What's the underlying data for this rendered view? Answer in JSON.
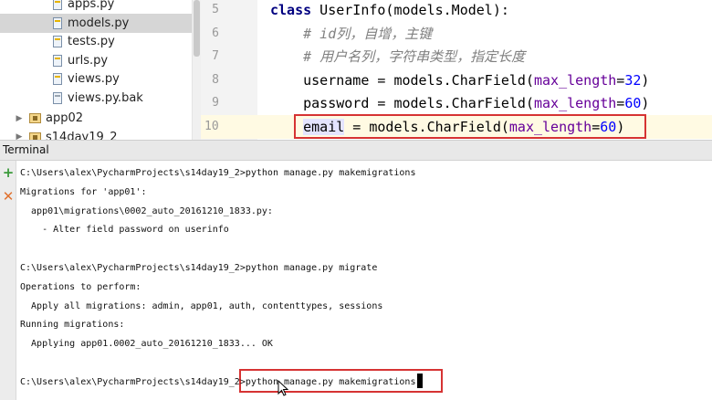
{
  "project_tree": {
    "files": [
      {
        "label": "apps.py",
        "selected": false,
        "icon": "python-file-icon"
      },
      {
        "label": "models.py",
        "selected": true,
        "icon": "python-file-icon"
      },
      {
        "label": "tests.py",
        "selected": false,
        "icon": "python-file-icon"
      },
      {
        "label": "urls.py",
        "selected": false,
        "icon": "python-file-icon"
      },
      {
        "label": "views.py",
        "selected": false,
        "icon": "python-file-icon"
      },
      {
        "label": "views.py.bak",
        "selected": false,
        "icon": "text-file-icon"
      }
    ],
    "folders": [
      {
        "label": "app02",
        "icon": "package-folder-icon"
      },
      {
        "label": "s14day19_2",
        "icon": "package-folder-icon"
      }
    ]
  },
  "editor": {
    "lines": [
      {
        "num": "5",
        "segments": [
          {
            "t": "class",
            "c": "kw"
          },
          {
            "t": " UserInfo(models.Model):",
            "c": ""
          }
        ]
      },
      {
        "num": "6",
        "segments": [
          {
            "t": "    # id列，自增，主键",
            "c": "cm"
          }
        ]
      },
      {
        "num": "7",
        "segments": [
          {
            "t": "    # 用户名列，字符串类型，指定长度",
            "c": "cm"
          }
        ]
      },
      {
        "num": "8",
        "segments": [
          {
            "t": "    username = models.CharField(",
            "c": ""
          },
          {
            "t": "max_length",
            "c": "kwarg"
          },
          {
            "t": "=",
            "c": ""
          },
          {
            "t": "32",
            "c": "num"
          },
          {
            "t": ")",
            "c": ""
          }
        ]
      },
      {
        "num": "9",
        "segments": [
          {
            "t": "    password = models.CharField(",
            "c": ""
          },
          {
            "t": "max_length",
            "c": "kwarg"
          },
          {
            "t": "=",
            "c": ""
          },
          {
            "t": "60",
            "c": "num"
          },
          {
            "t": ")",
            "c": ""
          }
        ]
      },
      {
        "num": "10",
        "current": true,
        "segments": [
          {
            "t": "    ",
            "c": ""
          },
          {
            "t": "email",
            "c": "hilite"
          },
          {
            "t": " = models.CharField(",
            "c": ""
          },
          {
            "t": "max_length",
            "c": "kwarg"
          },
          {
            "t": "=",
            "c": ""
          },
          {
            "t": "60",
            "c": "num"
          },
          {
            "t": ")",
            "c": ""
          }
        ]
      }
    ]
  },
  "terminal": {
    "title": "Terminal",
    "buttons": {
      "new_session": "+",
      "close_session": "✕"
    },
    "lines": [
      "C:\\Users\\alex\\PycharmProjects\\s14day19_2>python manage.py makemigrations",
      "Migrations for 'app01':",
      "  app01\\migrations\\0002_auto_20161210_1833.py:",
      "    - Alter field password on userinfo",
      "",
      "C:\\Users\\alex\\PycharmProjects\\s14day19_2>python manage.py migrate",
      "Operations to perform:",
      "  Apply all migrations: admin, app01, auth, contenttypes, sessions",
      "Running migrations:",
      "  Applying app01.0002_auto_20161210_1833... OK",
      "",
      "C:\\Users\\alex\\PycharmProjects\\s14day19_2>python manage.py makemigrations"
    ]
  },
  "colors": {
    "highlight_box": "#d63333",
    "keyword": "#000080",
    "comment": "#808080",
    "kwarg": "#660099",
    "number": "#0000ff"
  }
}
